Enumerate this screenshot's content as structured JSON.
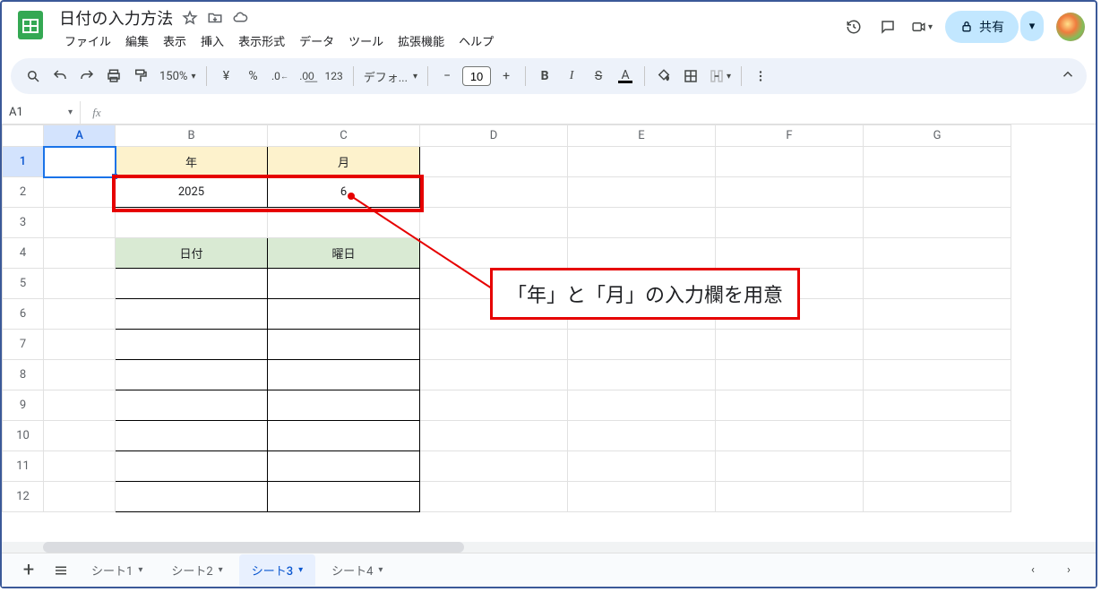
{
  "doc": {
    "title": "日付の入力方法"
  },
  "menus": {
    "file": "ファイル",
    "edit": "編集",
    "view": "表示",
    "insert": "挿入",
    "format": "表示形式",
    "data": "データ",
    "tools": "ツール",
    "extensions": "拡張機能",
    "help": "ヘルプ"
  },
  "share": {
    "label": "共有"
  },
  "toolbar": {
    "zoom": "150%",
    "currency": "¥",
    "percent": "%",
    "dec_dec": ".0",
    "dec_inc": ".00",
    "num123": "123",
    "font": "デフォ...",
    "font_size": "10"
  },
  "namebox": {
    "ref": "A1"
  },
  "columns": [
    "A",
    "B",
    "C",
    "D",
    "E",
    "F",
    "G"
  ],
  "rows": [
    "1",
    "2",
    "3",
    "4",
    "5",
    "6",
    "7",
    "8",
    "9",
    "10",
    "11",
    "12"
  ],
  "cells": {
    "B1": "年",
    "C1": "月",
    "B2": "2025",
    "C2": "6",
    "B4": "日付",
    "C4": "曜日"
  },
  "annotation": {
    "text": "「年」と「月」の入力欄を用意"
  },
  "tabs": {
    "sheet1": "シート1",
    "sheet2": "シート2",
    "sheet3": "シート3",
    "sheet4": "シート4"
  }
}
